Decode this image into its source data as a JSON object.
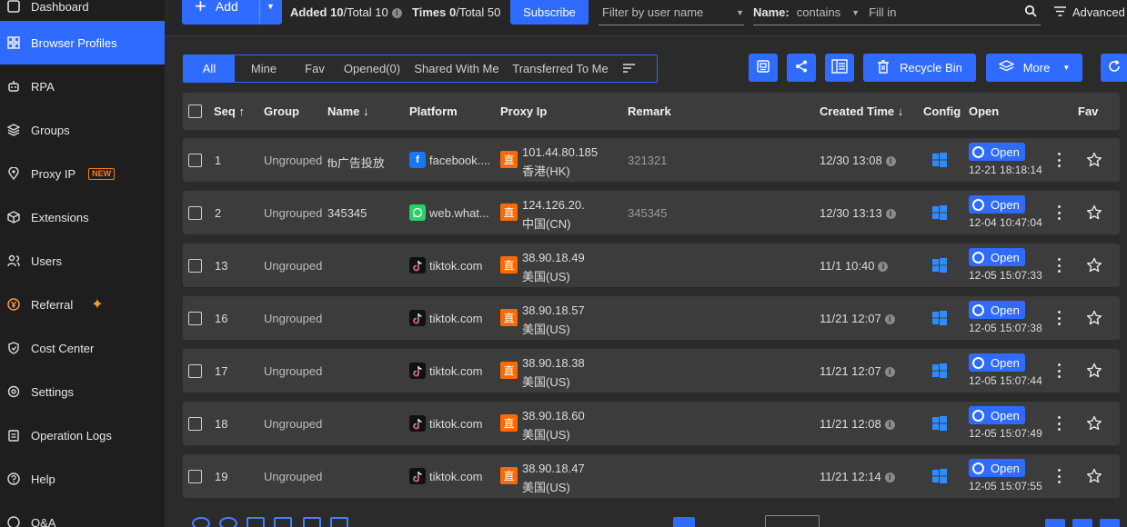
{
  "sidebar": {
    "items": [
      {
        "label": "Dashboard",
        "icon": "dashboard-icon"
      },
      {
        "label": "Browser Profiles",
        "icon": "grid-icon",
        "active": true
      },
      {
        "label": "RPA",
        "icon": "robot-icon"
      },
      {
        "label": "Groups",
        "icon": "layers-icon"
      },
      {
        "label": "Proxy IP",
        "icon": "location-icon",
        "badge": "NEW"
      },
      {
        "label": "Extensions",
        "icon": "cube-icon"
      },
      {
        "label": "Users",
        "icon": "users-icon"
      },
      {
        "label": "Referral",
        "icon": "referral-icon"
      },
      {
        "label": "Cost Center",
        "icon": "shield-icon"
      },
      {
        "label": "Settings",
        "icon": "gear-icon"
      },
      {
        "label": "Operation Logs",
        "icon": "clipboard-icon"
      },
      {
        "label": "Help",
        "icon": "help-icon"
      },
      {
        "label": "Q&A",
        "icon": "qa-icon"
      }
    ]
  },
  "toolbar": {
    "add_label": "Add",
    "added_label": "Added",
    "added_count": "10",
    "added_total": "/Total 10",
    "times_label": "Times",
    "times_count": "0",
    "times_total": "/Total 50",
    "subscribe_label": "Subscribe",
    "filter_user_placeholder": "Filter by user name",
    "name_label": "Name:",
    "name_mode": "contains",
    "fill_in_placeholder": "Fill in",
    "advanced_label": "Advanced"
  },
  "tabs": [
    "All",
    "Mine",
    "Fav",
    "Opened(0)",
    "Shared With Me",
    "Transferred To Me"
  ],
  "actions": {
    "recycle_label": "Recycle Bin",
    "more_label": "More"
  },
  "columns": {
    "seq": "Seq",
    "group": "Group",
    "name": "Name",
    "platform": "Platform",
    "proxy": "Proxy Ip",
    "remark": "Remark",
    "created": "Created Time",
    "config": "Config",
    "open": "Open",
    "fav": "Fav"
  },
  "open_label": "Open",
  "zhi_label": "直",
  "rows": [
    {
      "seq": "1",
      "group": "Ungrouped",
      "name": "fb广告投放",
      "platform": "facebook....",
      "platform_icon": "facebook-icon",
      "ip": "101.44.80.185",
      "region": "香港(HK)",
      "remark": "321321",
      "created": "12/30 13:08",
      "opened": "12-21 18:18:14"
    },
    {
      "seq": "2",
      "group": "Ungrouped",
      "name": "345345",
      "platform": "web.what...",
      "platform_icon": "whatsapp-icon",
      "ip": "124.126.20.",
      "region": "中国(CN)",
      "remark": "345345",
      "created": "12/30 13:13",
      "opened": "12-04 10:47:04"
    },
    {
      "seq": "13",
      "group": "Ungrouped",
      "name": "",
      "platform": "tiktok.com",
      "platform_icon": "tiktok-icon",
      "ip": "38.90.18.49",
      "region": "美国(US)",
      "remark": "",
      "created": "11/1 10:40",
      "opened": "12-05 15:07:33"
    },
    {
      "seq": "16",
      "group": "Ungrouped",
      "name": "",
      "platform": "tiktok.com",
      "platform_icon": "tiktok-icon",
      "ip": "38.90.18.57",
      "region": "美国(US)",
      "remark": "",
      "created": "11/21 12:07",
      "opened": "12-05 15:07:38"
    },
    {
      "seq": "17",
      "group": "Ungrouped",
      "name": "",
      "platform": "tiktok.com",
      "platform_icon": "tiktok-icon",
      "ip": "38.90.18.38",
      "region": "美国(US)",
      "remark": "",
      "created": "11/21 12:07",
      "opened": "12-05 15:07:44"
    },
    {
      "seq": "18",
      "group": "Ungrouped",
      "name": "",
      "platform": "tiktok.com",
      "platform_icon": "tiktok-icon",
      "ip": "38.90.18.60",
      "region": "美国(US)",
      "remark": "",
      "created": "11/21 12:08",
      "opened": "12-05 15:07:49"
    },
    {
      "seq": "19",
      "group": "Ungrouped",
      "name": "",
      "platform": "tiktok.com",
      "platform_icon": "tiktok-icon",
      "ip": "38.90.18.47",
      "region": "美国(US)",
      "remark": "",
      "created": "11/21 12:14",
      "opened": "12-05 15:07:55"
    }
  ],
  "colors": {
    "accent": "#2f6bff",
    "proxy_badge": "#ff6a00",
    "new_badge": "#ff7a1a"
  }
}
